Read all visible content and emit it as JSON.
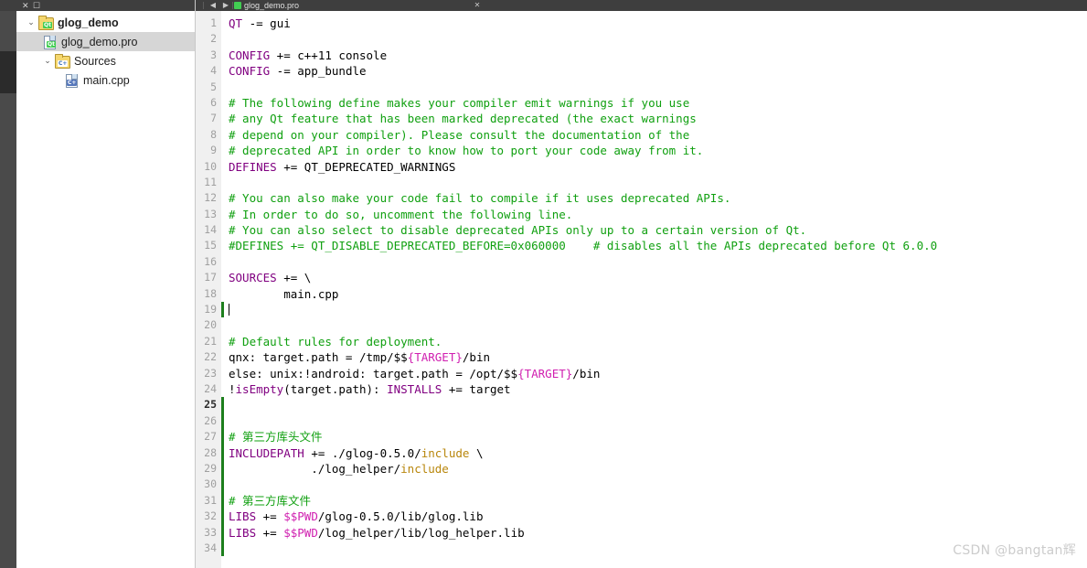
{
  "window": {
    "left_strip_tooltip": "activity-bar"
  },
  "project_tree": {
    "header_icons": "✕ ☐",
    "items": [
      {
        "label": "glog_demo",
        "icon": "qt-project-folder-icon",
        "badge": "Qt",
        "twisty": "⌄",
        "indent": 0,
        "bold": true,
        "selected": false
      },
      {
        "label": "glog_demo.pro",
        "icon": "qt-pro-file-icon",
        "badge": "Qt",
        "twisty": "",
        "indent": 1,
        "bold": false,
        "selected": true
      },
      {
        "label": "Sources",
        "icon": "cpp-folder-icon",
        "badge": "C+",
        "twisty": "⌄",
        "indent": 2,
        "bold": false,
        "selected": false
      },
      {
        "label": "main.cpp",
        "icon": "cpp-file-icon",
        "badge": "C+",
        "twisty": "",
        "indent": 3,
        "bold": false,
        "selected": false
      }
    ]
  },
  "editor": {
    "tab_label": "glog_demo.pro",
    "close_label": "✕",
    "current_line": 25,
    "caret_line": 19,
    "changed_lines": [
      19,
      25,
      26,
      27,
      28,
      29,
      30,
      31,
      32,
      33,
      34
    ],
    "line_numbers": [
      1,
      2,
      3,
      4,
      5,
      6,
      7,
      8,
      9,
      10,
      11,
      12,
      13,
      14,
      15,
      16,
      17,
      18,
      19,
      20,
      21,
      22,
      23,
      24,
      25,
      26,
      27,
      28,
      29,
      30,
      31,
      32,
      33,
      34
    ],
    "lines": [
      [
        {
          "t": "QT",
          "c": "t-var"
        },
        {
          "t": " -= gui",
          "c": "t-op"
        }
      ],
      [],
      [
        {
          "t": "CONFIG",
          "c": "t-var"
        },
        {
          "t": " += c++11 console",
          "c": "t-op"
        }
      ],
      [
        {
          "t": "CONFIG",
          "c": "t-var"
        },
        {
          "t": " -= app_bundle",
          "c": "t-op"
        }
      ],
      [],
      [
        {
          "t": "# The following define makes your compiler emit warnings if you use",
          "c": "t-com"
        }
      ],
      [
        {
          "t": "# any Qt feature that has been marked deprecated (the exact warnings",
          "c": "t-com"
        }
      ],
      [
        {
          "t": "# depend on your compiler). Please consult the documentation of the",
          "c": "t-com"
        }
      ],
      [
        {
          "t": "# deprecated API in order to know how to port your code away from it.",
          "c": "t-com"
        }
      ],
      [
        {
          "t": "DEFINES",
          "c": "t-var"
        },
        {
          "t": " += QT_DEPRECATED_WARNINGS",
          "c": "t-op"
        }
      ],
      [],
      [
        {
          "t": "# You can also make your code fail to compile if it uses deprecated APIs.",
          "c": "t-com"
        }
      ],
      [
        {
          "t": "# In order to do so, uncomment the following line.",
          "c": "t-com"
        }
      ],
      [
        {
          "t": "# You can also select to disable deprecated APIs only up to a certain version of Qt.",
          "c": "t-com"
        }
      ],
      [
        {
          "t": "#DEFINES += QT_DISABLE_DEPRECATED_BEFORE=0x060000    # disables all the APIs deprecated before Qt 6.0.0",
          "c": "t-com"
        }
      ],
      [],
      [
        {
          "t": "SOURCES",
          "c": "t-var"
        },
        {
          "t": " += \\",
          "c": "t-op"
        }
      ],
      [
        {
          "t": "        main.cpp",
          "c": "t-op"
        }
      ],
      [
        {
          "t": "",
          "c": "caret"
        }
      ],
      [],
      [
        {
          "t": "# Default rules for deployment.",
          "c": "t-com"
        }
      ],
      [
        {
          "t": "qnx: target.path = /tmp/$$",
          "c": "t-op"
        },
        {
          "t": "{TARGET}",
          "c": "t-mag"
        },
        {
          "t": "/bin",
          "c": "t-op"
        }
      ],
      [
        {
          "t": "else: unix:!android: target.path = /opt/$$",
          "c": "t-op"
        },
        {
          "t": "{TARGET}",
          "c": "t-mag"
        },
        {
          "t": "/bin",
          "c": "t-op"
        }
      ],
      [
        {
          "t": "!",
          "c": "t-op"
        },
        {
          "t": "isEmpty",
          "c": "t-fn"
        },
        {
          "t": "(target.path): ",
          "c": "t-op"
        },
        {
          "t": "INSTALLS",
          "c": "t-var"
        },
        {
          "t": " += target",
          "c": "t-op"
        }
      ],
      [],
      [],
      [
        {
          "t": "# 第三方库头文件",
          "c": "t-com"
        }
      ],
      [
        {
          "t": "INCLUDEPATH",
          "c": "t-var"
        },
        {
          "t": " += ./glog-0.5.0/",
          "c": "t-op"
        },
        {
          "t": "include",
          "c": "t-inc"
        },
        {
          "t": " \\",
          "c": "t-op"
        }
      ],
      [
        {
          "t": "            ./log_helper/",
          "c": "t-op"
        },
        {
          "t": "include",
          "c": "t-inc"
        }
      ],
      [],
      [
        {
          "t": "# 第三方库文件",
          "c": "t-com"
        }
      ],
      [
        {
          "t": "LIBS",
          "c": "t-var"
        },
        {
          "t": " += ",
          "c": "t-op"
        },
        {
          "t": "$$PWD",
          "c": "t-mag"
        },
        {
          "t": "/glog-0.5.0/lib/glog.lib",
          "c": "t-op"
        }
      ],
      [
        {
          "t": "LIBS",
          "c": "t-var"
        },
        {
          "t": " += ",
          "c": "t-op"
        },
        {
          "t": "$$PWD",
          "c": "t-mag"
        },
        {
          "t": "/log_helper/lib/log_helper.lib",
          "c": "t-op"
        }
      ],
      []
    ]
  },
  "watermark": {
    "text": "CSDN @bangtan辉"
  },
  "colors": {
    "keyword": "#800080",
    "comment": "#10a010",
    "macro": "#d020b0",
    "include": "#b8860b",
    "changebar": "#1d7f1d",
    "chrome": "#3e3e3e",
    "gutter_bg": "#f0f0f0",
    "selection": "#d6d6d6"
  }
}
